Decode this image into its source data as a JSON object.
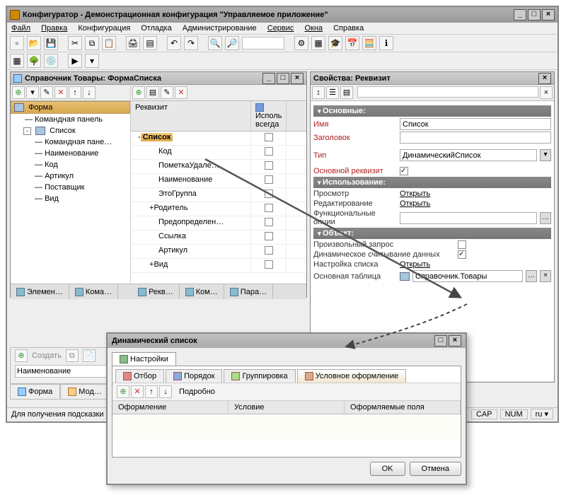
{
  "main": {
    "title": "Конфигуратор - Демонстрационная конфигурация \"Управляемое приложение\"",
    "menu": [
      "Файл",
      "Правка",
      "Конфигурация",
      "Отладка",
      "Администрирование",
      "Сервис",
      "Окна",
      "Справка"
    ]
  },
  "formEditor": {
    "title": "Справочник Товары: ФормаСписка",
    "treeLeft": {
      "root": "Форма",
      "items": [
        "Командная панель",
        "Список"
      ],
      "sublist": [
        "Командная пане…",
        "Наименование",
        "Код",
        "Артикул",
        "Поставщик",
        "Вид"
      ]
    },
    "gridHeader": {
      "col1": "Реквизит",
      "col2": "Исполь\nвсегда"
    },
    "gridRows": [
      {
        "label": "Список",
        "indent": 0,
        "expander": "-",
        "sel": true
      },
      {
        "label": "Код",
        "indent": 1
      },
      {
        "label": "ПометкаУдале…",
        "indent": 1
      },
      {
        "label": "Наименование",
        "indent": 1
      },
      {
        "label": "ЭтоГруппа",
        "indent": 1
      },
      {
        "label": "Родитель",
        "indent": 1,
        "expander": "+"
      },
      {
        "label": "Предопределен…",
        "indent": 1
      },
      {
        "label": "Ссылка",
        "indent": 1
      },
      {
        "label": "Артикул",
        "indent": 1
      },
      {
        "label": "Вид",
        "indent": 1,
        "expander": "+"
      }
    ],
    "tabs": [
      "Элемен…",
      "Кома…"
    ],
    "tabs2": [
      "Рекв…",
      "Ком…",
      "Пара…"
    ]
  },
  "props": {
    "title": "Свойства: Реквизит",
    "sections": {
      "main": "Основные:",
      "usage": "Использование:",
      "object": "Объект:"
    },
    "labels": {
      "name": "Имя",
      "header": "Заголовок",
      "type": "Тип",
      "mainReq": "Основной реквизит",
      "view": "Просмотр",
      "edit": "Редактирование",
      "funcOpts": "Функциональные опции",
      "customQuery": "Произвольный запрос",
      "dynRead": "Динамическое считывание данных",
      "listSetup": "Настройка списка",
      "mainTable": "Основная таблица"
    },
    "values": {
      "name": "Список",
      "type": "ДинамическийСписок",
      "mainTable": "Справочник.Товары",
      "open": "Открыть"
    }
  },
  "bottomBar": {
    "create": "Создать",
    "field": "Наименование"
  },
  "lastTabs": [
    "Форма",
    "Мод…"
  ],
  "status": {
    "hint": "Для получения подсказки",
    "cap": "CAP",
    "num": "NUM",
    "lang": "ru"
  },
  "dialog": {
    "title": "Динамический список",
    "mainTab": "Настройки",
    "subTabs": [
      "Отбор",
      "Порядок",
      "Группировка",
      "Условное оформление"
    ],
    "detail": "Подробно",
    "gridCols": [
      "Оформление",
      "Условие",
      "Оформляемые поля"
    ],
    "ok": "OK",
    "cancel": "Отмена"
  }
}
